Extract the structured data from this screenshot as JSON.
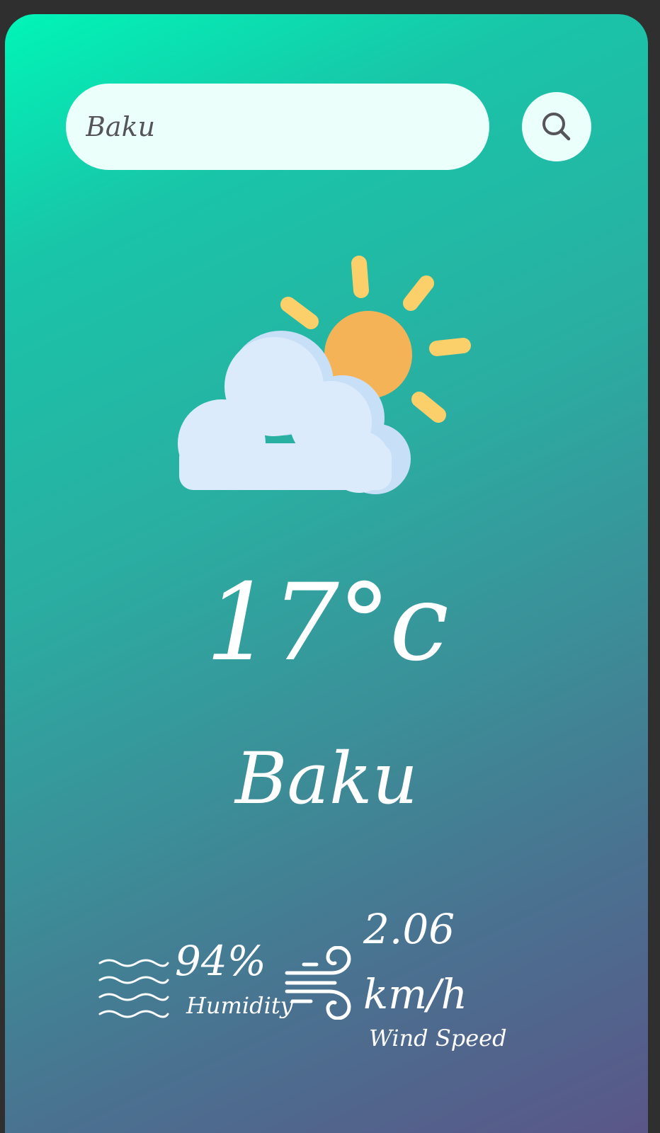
{
  "search": {
    "value": "Baku",
    "icon": "search-icon"
  },
  "weather": {
    "icon": "partly-cloudy-icon",
    "temperature": "17°c",
    "city": "Baku"
  },
  "details": {
    "humidity": {
      "icon": "humidity-waves-icon",
      "value": "94%",
      "label": "Humidity"
    },
    "wind": {
      "icon": "wind-icon",
      "value": "2.06 km/h",
      "label": "Wind Speed"
    }
  },
  "colors": {
    "gradient_start": "#00f5b8",
    "gradient_end": "#5a5688",
    "input_bg": "#ebfffb",
    "sun": "#f5b358",
    "sun_rays": "#fbd06a",
    "cloud": "#dcebfb",
    "cloud_shade": "#c8e0f7",
    "text": "#ffffff"
  }
}
